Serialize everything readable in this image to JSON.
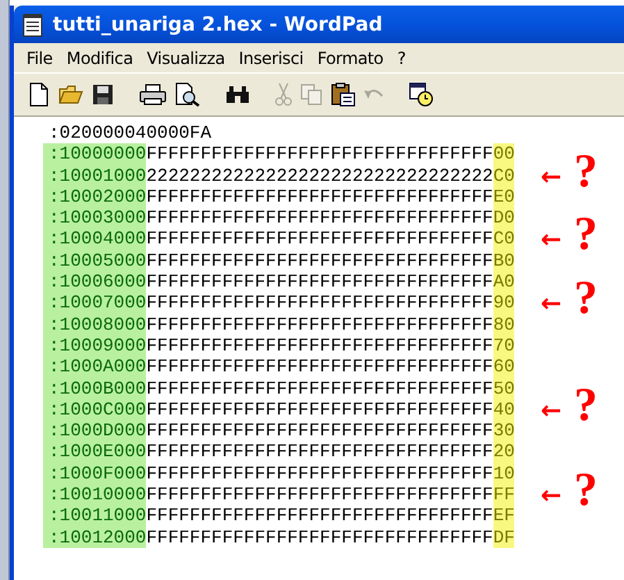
{
  "window": {
    "title": "tutti_unariga 2.hex - WordPad"
  },
  "menu": [
    "File",
    "Modifica",
    "Visualizza",
    "Inserisci",
    "Formato",
    "?"
  ],
  "toolbar": [
    {
      "kind": "new",
      "disabled": false
    },
    {
      "kind": "open",
      "disabled": false
    },
    {
      "kind": "save",
      "disabled": false
    },
    {
      "kind": "sep"
    },
    {
      "kind": "print",
      "disabled": false
    },
    {
      "kind": "preview",
      "disabled": false
    },
    {
      "kind": "sep"
    },
    {
      "kind": "find",
      "disabled": false
    },
    {
      "kind": "sep"
    },
    {
      "kind": "cut",
      "disabled": true
    },
    {
      "kind": "copy",
      "disabled": true
    },
    {
      "kind": "paste",
      "disabled": false
    },
    {
      "kind": "undo",
      "disabled": true
    },
    {
      "kind": "sep"
    },
    {
      "kind": "datetime",
      "disabled": false
    }
  ],
  "header_line": ":020000040000FA",
  "rows": [
    {
      "address": ":10000000",
      "data": "FFFFFFFFFFFFFFFFFFFFFFFFFFFFFFFF",
      "checksum": "00",
      "annotation": null
    },
    {
      "address": ":10001000",
      "data": "22222222222222222222222222222222",
      "checksum": "C0",
      "annotation": {
        "arrow": "←",
        "mark": "?"
      }
    },
    {
      "address": ":10002000",
      "data": "FFFFFFFFFFFFFFFFFFFFFFFFFFFFFFFF",
      "checksum": "E0",
      "annotation": null
    },
    {
      "address": ":10003000",
      "data": "FFFFFFFFFFFFFFFFFFFFFFFFFFFFFFFF",
      "checksum": "D0",
      "annotation": null
    },
    {
      "address": ":10004000",
      "data": "FFFFFFFFFFFFFFFFFFFFFFFFFFFFFFFF",
      "checksum": "C0",
      "annotation": {
        "arrow": "←",
        "mark": "?"
      }
    },
    {
      "address": ":10005000",
      "data": "FFFFFFFFFFFFFFFFFFFFFFFFFFFFFFFF",
      "checksum": "B0",
      "annotation": null
    },
    {
      "address": ":10006000",
      "data": "FFFFFFFFFFFFFFFFFFFFFFFFFFFFFFFF",
      "checksum": "A0",
      "annotation": null
    },
    {
      "address": ":10007000",
      "data": "FFFFFFFFFFFFFFFFFFFFFFFFFFFFFFFF",
      "checksum": "90",
      "annotation": {
        "arrow": "←",
        "mark": "?"
      }
    },
    {
      "address": ":10008000",
      "data": "FFFFFFFFFFFFFFFFFFFFFFFFFFFFFFFF",
      "checksum": "80",
      "annotation": null
    },
    {
      "address": ":10009000",
      "data": "FFFFFFFFFFFFFFFFFFFFFFFFFFFFFFFF",
      "checksum": "70",
      "annotation": null
    },
    {
      "address": ":1000A000",
      "data": "FFFFFFFFFFFFFFFFFFFFFFFFFFFFFFFF",
      "checksum": "60",
      "annotation": null
    },
    {
      "address": ":1000B000",
      "data": "FFFFFFFFFFFFFFFFFFFFFFFFFFFFFFFF",
      "checksum": "50",
      "annotation": null
    },
    {
      "address": ":1000C000",
      "data": "FFFFFFFFFFFFFFFFFFFFFFFFFFFFFFFF",
      "checksum": "40",
      "annotation": {
        "arrow": "←",
        "mark": "?"
      }
    },
    {
      "address": ":1000D000",
      "data": "FFFFFFFFFFFFFFFFFFFFFFFFFFFFFFFF",
      "checksum": "30",
      "annotation": null
    },
    {
      "address": ":1000E000",
      "data": "FFFFFFFFFFFFFFFFFFFFFFFFFFFFFFFF",
      "checksum": "20",
      "annotation": null
    },
    {
      "address": ":1000F000",
      "data": "FFFFFFFFFFFFFFFFFFFFFFFFFFFFFFFF",
      "checksum": "10",
      "annotation": null
    },
    {
      "address": ":10010000",
      "data": "FFFFFFFFFFFFFFFFFFFFFFFFFFFFFFFF",
      "checksum": "FF",
      "annotation": {
        "arrow": "←",
        "mark": "?"
      }
    },
    {
      "address": ":10011000",
      "data": "FFFFFFFFFFFFFFFFFFFFFFFFFFFFFFFF",
      "checksum": "EF",
      "annotation": null
    },
    {
      "address": ":10012000",
      "data": "FFFFFFFFFFFFFFFFFFFFFFFFFFFFFFFF",
      "checksum": "DF",
      "annotation": null
    }
  ]
}
